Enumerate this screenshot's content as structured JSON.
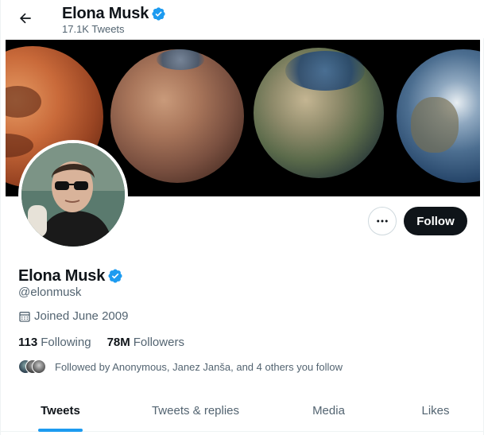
{
  "header": {
    "name": "Elona Musk",
    "tweet_count": "17.1K Tweets",
    "back_icon": "arrow-left-icon",
    "verified_icon": "verified-badge-icon"
  },
  "profile": {
    "display_name": "Elona Musk",
    "handle": "@elonmusk",
    "joined": "Joined June 2009",
    "following_count": "113",
    "following_label": "Following",
    "followers_count": "78M",
    "followers_label": "Followers",
    "followed_by": "Followed by Anonymous, Janez Janša, and 4 others you follow"
  },
  "actions": {
    "more_icon": "more-dots-icon",
    "follow_label": "Follow"
  },
  "tabs": [
    {
      "label": "Tweets",
      "active": true
    },
    {
      "label": "Tweets & replies",
      "active": false
    },
    {
      "label": "Media",
      "active": false
    },
    {
      "label": "Likes",
      "active": false
    }
  ],
  "colors": {
    "accent": "#1d9bf0",
    "text_primary": "#0f1419",
    "text_secondary": "#536471",
    "follow_button_bg": "#0f1419"
  }
}
